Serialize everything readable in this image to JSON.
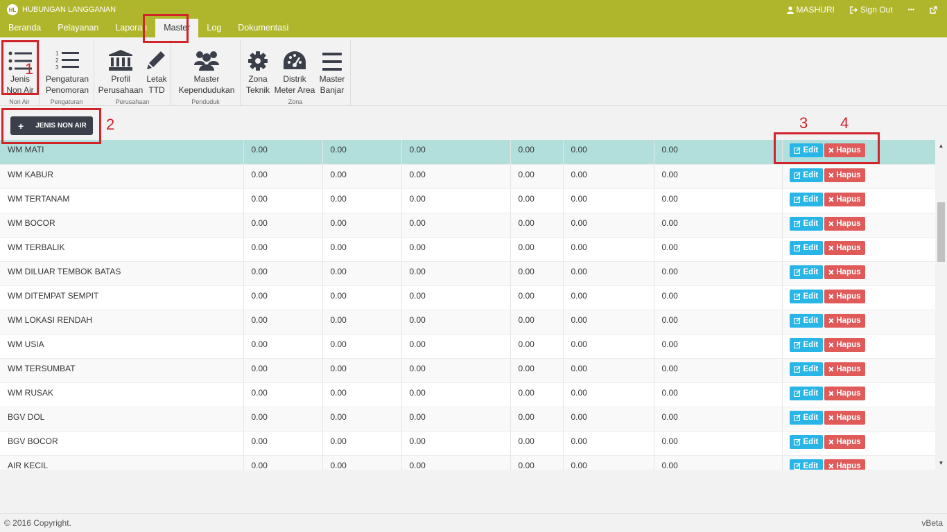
{
  "app": {
    "title": "HUBUNGAN LANGGANAN",
    "logo_text": "HL"
  },
  "user": {
    "name": "MASHURI",
    "signout_label": "Sign Out",
    "more_label": "•••"
  },
  "menu": {
    "tabs": [
      "Beranda",
      "Pelayanan",
      "Laporan",
      "Master",
      "Log",
      "Dokumentasi"
    ],
    "active": "Master"
  },
  "ribbon": {
    "groups": [
      {
        "name": "Non Air",
        "buttons": [
          {
            "line1": "Jenis",
            "line2": "Non Air",
            "icon": "list-icon"
          }
        ]
      },
      {
        "name": "Pengaturan",
        "buttons": [
          {
            "line1": "Pengaturan",
            "line2": "Penomoran",
            "icon": "numbered-list-icon"
          }
        ]
      },
      {
        "name": "Perusahaan",
        "buttons": [
          {
            "line1": "Profil",
            "line2": "Perusahaan",
            "icon": "bank-icon"
          },
          {
            "line1": "Letak",
            "line2": "TTD",
            "icon": "pencil-icon"
          }
        ]
      },
      {
        "name": "Penduduk",
        "buttons": [
          {
            "line1": "Master",
            "line2": "Kependudukan",
            "icon": "users-icon"
          }
        ]
      },
      {
        "name": "Zona",
        "buttons": [
          {
            "line1": "Zona",
            "line2": "Teknik",
            "icon": "gear-icon"
          },
          {
            "line1": "Distrik",
            "line2": "Meter Area",
            "icon": "dashboard-icon"
          },
          {
            "line1": "Master",
            "line2": "Banjar",
            "icon": "bars-icon"
          }
        ]
      }
    ]
  },
  "toolbar": {
    "add_label": "JENIS NON AIR",
    "add_icon": "+"
  },
  "annotations": [
    "1",
    "2",
    "3",
    "4"
  ],
  "table": {
    "edit_label": "Edit",
    "delete_label": "Hapus",
    "rows": [
      {
        "name": "WM MATI",
        "v": [
          "0.00",
          "0.00",
          "0.00",
          "0.00",
          "0.00",
          "0.00"
        ],
        "selected": true
      },
      {
        "name": "WM KABUR",
        "v": [
          "0.00",
          "0.00",
          "0.00",
          "0.00",
          "0.00",
          "0.00"
        ]
      },
      {
        "name": "WM TERTANAM",
        "v": [
          "0.00",
          "0.00",
          "0.00",
          "0.00",
          "0.00",
          "0.00"
        ]
      },
      {
        "name": "WM BOCOR",
        "v": [
          "0.00",
          "0.00",
          "0.00",
          "0.00",
          "0.00",
          "0.00"
        ]
      },
      {
        "name": "WM TERBALIK",
        "v": [
          "0.00",
          "0.00",
          "0.00",
          "0.00",
          "0.00",
          "0.00"
        ]
      },
      {
        "name": "WM DILUAR TEMBOK BATAS",
        "v": [
          "0.00",
          "0.00",
          "0.00",
          "0.00",
          "0.00",
          "0.00"
        ]
      },
      {
        "name": "WM DITEMPAT SEMPIT",
        "v": [
          "0.00",
          "0.00",
          "0.00",
          "0.00",
          "0.00",
          "0.00"
        ]
      },
      {
        "name": "WM LOKASI RENDAH",
        "v": [
          "0.00",
          "0.00",
          "0.00",
          "0.00",
          "0.00",
          "0.00"
        ]
      },
      {
        "name": "WM USIA",
        "v": [
          "0.00",
          "0.00",
          "0.00",
          "0.00",
          "0.00",
          "0.00"
        ]
      },
      {
        "name": "WM TERSUMBAT",
        "v": [
          "0.00",
          "0.00",
          "0.00",
          "0.00",
          "0.00",
          "0.00"
        ]
      },
      {
        "name": "WM RUSAK",
        "v": [
          "0.00",
          "0.00",
          "0.00",
          "0.00",
          "0.00",
          "0.00"
        ]
      },
      {
        "name": "BGV DOL",
        "v": [
          "0.00",
          "0.00",
          "0.00",
          "0.00",
          "0.00",
          "0.00"
        ]
      },
      {
        "name": "BGV BOCOR",
        "v": [
          "0.00",
          "0.00",
          "0.00",
          "0.00",
          "0.00",
          "0.00"
        ]
      },
      {
        "name": "AIR KECIL",
        "v": [
          "0.00",
          "0.00",
          "0.00",
          "0.00",
          "0.00",
          "0.00"
        ]
      }
    ]
  },
  "footer": {
    "copyright": "© 2016 Copyright.",
    "version": "vBeta"
  },
  "colors": {
    "topbar": "#b0b62c",
    "selected_row": "#b2dfdb",
    "edit": "#29b6e6",
    "delete": "#e05a5a",
    "annotation": "#d1232a"
  }
}
